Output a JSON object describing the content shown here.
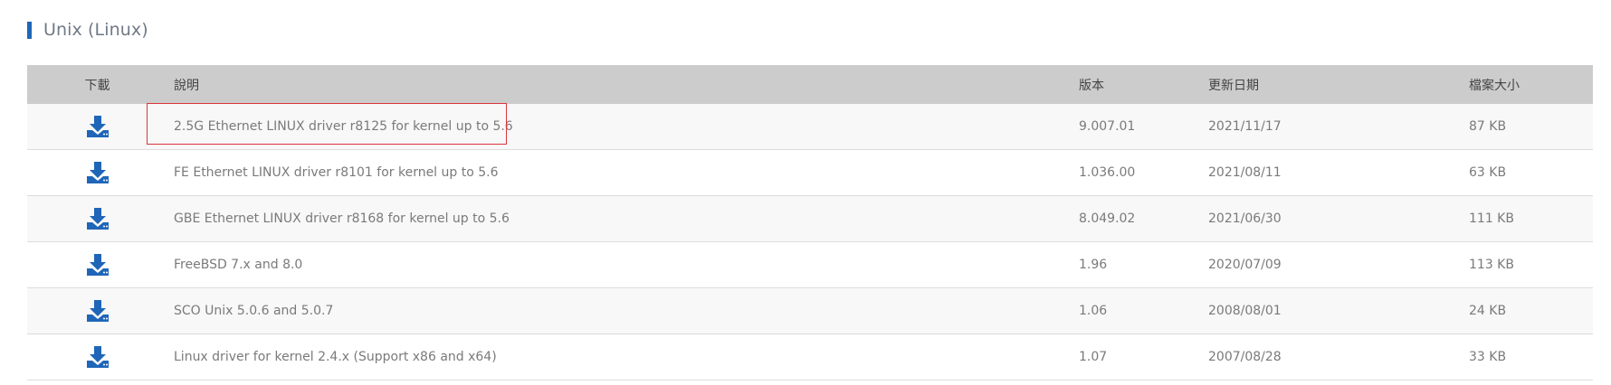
{
  "section": {
    "title": "Unix (Linux)"
  },
  "table": {
    "headers": {
      "download": "下載",
      "description": "說明",
      "version": "版本",
      "date": "更新日期",
      "size": "檔案大小"
    },
    "rows": [
      {
        "description": "2.5G Ethernet LINUX driver r8125 for kernel up to 5.6",
        "version": "9.007.01",
        "date": "2021/11/17",
        "size": "87 KB",
        "highlighted": true
      },
      {
        "description": "FE Ethernet LINUX driver r8101 for kernel up to 5.6",
        "version": "1.036.00",
        "date": "2021/08/11",
        "size": "63 KB"
      },
      {
        "description": "GBE Ethernet LINUX driver r8168 for kernel up to 5.6",
        "version": "8.049.02",
        "date": "2021/06/30",
        "size": "111 KB"
      },
      {
        "description": "FreeBSD 7.x and 8.0",
        "version": "1.96",
        "date": "2020/07/09",
        "size": "113 KB"
      },
      {
        "description": "SCO Unix 5.0.6 and 5.0.7",
        "version": "1.06",
        "date": "2008/08/01",
        "size": "24 KB"
      },
      {
        "description": "Linux driver for kernel 2.4.x (Support x86 and x64)",
        "version": "1.07",
        "date": "2007/08/28",
        "size": "33 KB"
      }
    ]
  },
  "icons": {
    "download": "download-icon"
  },
  "colors": {
    "accent": "#1f66b8",
    "header_bg": "#cccccc",
    "highlight": "#d9363a"
  }
}
